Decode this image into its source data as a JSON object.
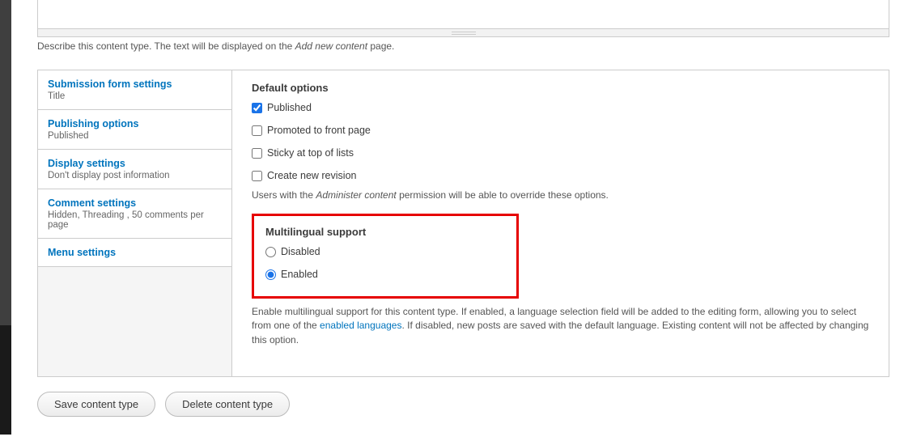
{
  "description": {
    "pre": "Describe this content type. The text will be displayed on the ",
    "italic": "Add new content",
    "post": " page."
  },
  "tabs": [
    {
      "title": "Submission form settings",
      "summary": "Title"
    },
    {
      "title": "Publishing options",
      "summary": "Published"
    },
    {
      "title": "Display settings",
      "summary": "Don't display post information"
    },
    {
      "title": "Comment settings",
      "summary": "Hidden, Threading , 50 comments per page"
    },
    {
      "title": "Menu settings",
      "summary": ""
    }
  ],
  "panel": {
    "default_heading": "Default options",
    "published": "Published",
    "promoted": "Promoted to front page",
    "sticky": "Sticky at top of lists",
    "revision": "Create new revision",
    "perm_help_pre": "Users with the ",
    "perm_help_italic": "Administer content",
    "perm_help_post": " permission will be able to override these options.",
    "multilingual_heading": "Multilingual support",
    "disabled": "Disabled",
    "enabled": "Enabled",
    "multi_help_pre": "Enable multilingual support for this content type. If enabled, a language selection field will be added to the editing form, allowing you to select from one of the ",
    "multi_help_link": "enabled languages",
    "multi_help_post": ". If disabled, new posts are saved with the default language. Existing content will not be affected by changing this option."
  },
  "buttons": {
    "save": "Save content type",
    "delete": "Delete content type"
  }
}
